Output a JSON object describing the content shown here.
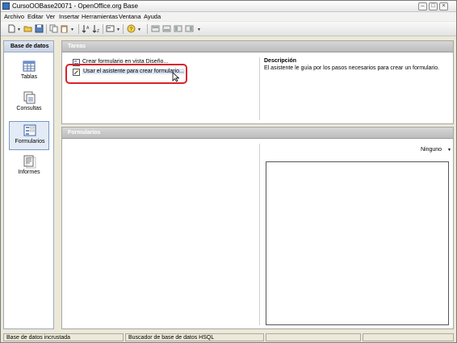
{
  "window": {
    "title": "CursoOOBase20071 - OpenOffice.org Base"
  },
  "menu": [
    "Archivo",
    "Editar",
    "Ver",
    "Insertar",
    "Herramientas",
    "Ventana",
    "Ayuda"
  ],
  "left_panel": {
    "header": "Base de datos",
    "items": [
      {
        "label": "Tablas",
        "icon": "table-icon"
      },
      {
        "label": "Consultas",
        "icon": "query-icon"
      },
      {
        "label": "Formularios",
        "icon": "form-icon",
        "selected": true
      },
      {
        "label": "Informes",
        "icon": "report-icon"
      }
    ]
  },
  "tasks_panel": {
    "header": "Tareas",
    "tasks": [
      "Crear formulario en vista Diseño...",
      "Usar el asistente para crear formulario..."
    ],
    "description_title": "Descripción",
    "description_text": "El asistente le guía por los pasos necesarios para crear un formulario."
  },
  "forms_panel": {
    "header": "Formularios",
    "preview_option": "Ninguno"
  },
  "status_bar": [
    "Base de datos incrustada",
    "Buscador de base de datos HSQL",
    "",
    ""
  ],
  "colors": {
    "highlight": "#d9232a",
    "selected_bg": "#e3ebf6"
  }
}
